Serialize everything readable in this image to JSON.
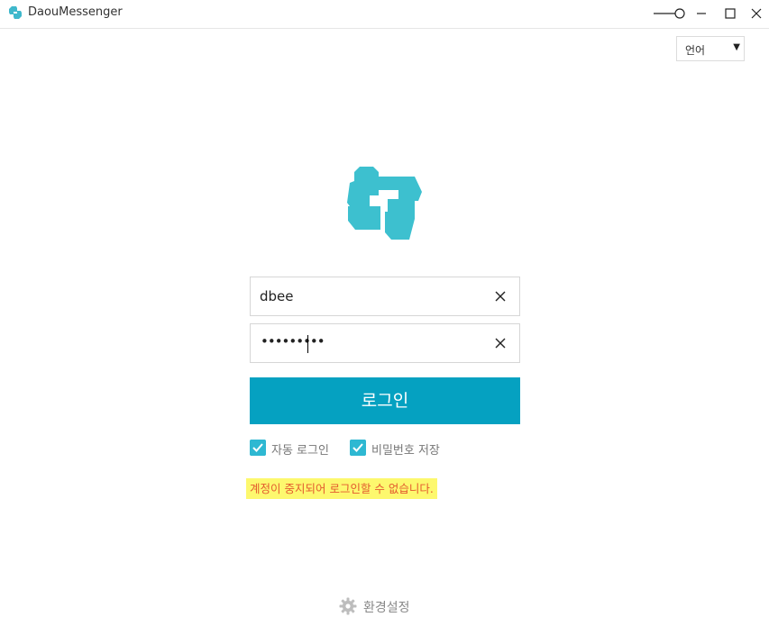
{
  "window": {
    "title": "DaouMessenger",
    "icons": [
      "app-logo-icon",
      "opacity-slider-icon",
      "minimize-icon",
      "maximize-icon",
      "close-icon"
    ]
  },
  "language": {
    "label": "언어",
    "arrow": "▼"
  },
  "login": {
    "username_value": "dbee",
    "password_masked": "•••••••••",
    "button_label": "로그인",
    "accent_color": "#05a1c1"
  },
  "options": {
    "auto_login_label": "자동 로그인",
    "auto_login_checked": true,
    "save_password_label": "비밀번호 저장",
    "save_password_checked": true
  },
  "error": {
    "message": "계정이 중지되어 로그인할 수 없습니다."
  },
  "footer": {
    "settings_label": "환경설정"
  }
}
